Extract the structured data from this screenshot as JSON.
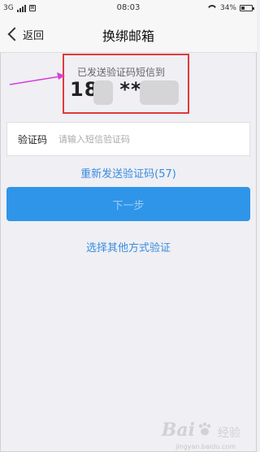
{
  "status_bar": {
    "network": "3G",
    "time": "08:03",
    "battery": "34%",
    "battery_level": 0.34
  },
  "nav": {
    "back_label": "返回",
    "title": "换绑邮箱"
  },
  "sent_info": {
    "hint": "已发送验证码短信到",
    "phone_prefix": "18",
    "phone_mask": "***"
  },
  "code_field": {
    "label": "验证码",
    "placeholder": "请输入短信验证码"
  },
  "resend_label": "重新发送验证码(57)",
  "next_button_label": "下一步",
  "other_method_label": "选择其他方式验证",
  "watermark": {
    "logo": "Bai",
    "logo_suffix": "经验",
    "url": "jingyan.baidu.com"
  },
  "colors": {
    "accent": "#2f95e9",
    "link": "#3a8cde",
    "highlight": "#e03a3a",
    "arrow": "#d63fd6"
  }
}
